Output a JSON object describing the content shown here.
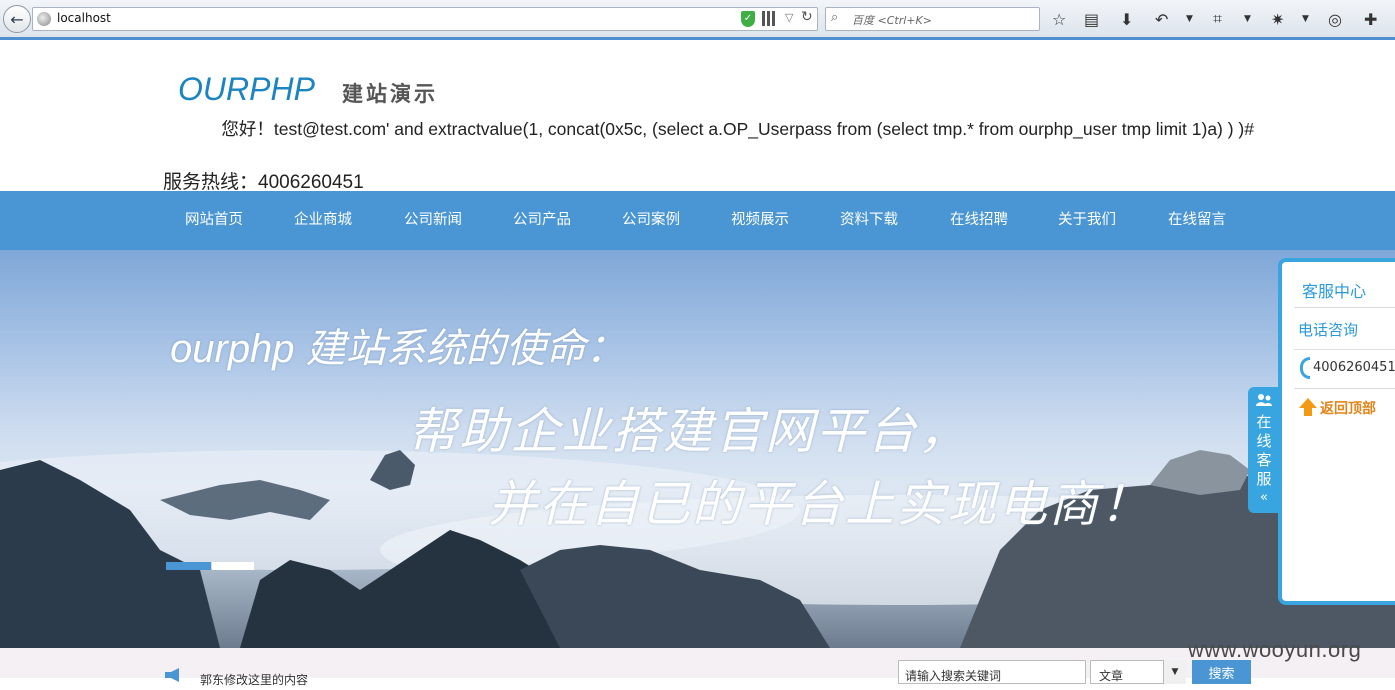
{
  "browser": {
    "url": "localhost",
    "search_placeholder": "百度 <Ctrl+K>"
  },
  "site": {
    "logo": "OURPHP",
    "logo_subtitle": "建站演示",
    "greeting": "您好！test@test.com' and extractvalue(1, concat(0x5c, (select a.OP_Userpass from (select tmp.* from ourphp_user tmp limit 1)a) ) )#",
    "hotline": "服务热线：4006260451"
  },
  "nav": {
    "items": [
      {
        "label": "网站首页"
      },
      {
        "label": "企业商城"
      },
      {
        "label": "公司新闻"
      },
      {
        "label": "公司产品"
      },
      {
        "label": "公司案例"
      },
      {
        "label": "视频展示"
      },
      {
        "label": "资料下载"
      },
      {
        "label": "在线招聘"
      },
      {
        "label": "关于我们"
      },
      {
        "label": "在线留言"
      }
    ]
  },
  "banner": {
    "line1": "ourphp 建站系统的使命：",
    "line2": "帮助企业搭建官网平台，",
    "line3": "并在自已的平台上实现电商！"
  },
  "footer": {
    "notice": "郭东修改这里的内容",
    "search_placeholder": "请输入搜索关键词",
    "search_type": "文章",
    "search_button": "搜索",
    "watermark": "www.wooyun.org"
  },
  "service": {
    "title": "客服中心",
    "phone_heading": "电话咨询",
    "phone_number": "4006260451",
    "back_to_top": "返回顶部",
    "tab_text": "在线客服",
    "tab_arrow": "«"
  },
  "colors": {
    "nav_bg": "#4a96d4",
    "accent": "#38a4e0",
    "logo": "#1b84c1"
  }
}
